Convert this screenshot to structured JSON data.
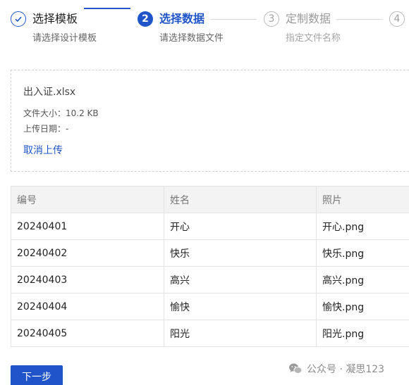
{
  "steps": [
    {
      "index": "1",
      "title": "选择模板",
      "description": "请选择设计模板",
      "status": "done",
      "icon": "check-icon"
    },
    {
      "index": "2",
      "title": "选择数据",
      "description": "请选择数据文件",
      "status": "active"
    },
    {
      "index": "3",
      "title": "定制数据",
      "description": "指定文件名称",
      "status": "wait"
    },
    {
      "index": "4",
      "title": "",
      "description": "",
      "status": "wait"
    }
  ],
  "upload": {
    "file_name": "出入证.xlsx",
    "size_text": "文件大小：10.2 KB",
    "date_text": "上传日期：-",
    "cancel_label": "取消上传"
  },
  "table": {
    "headers": [
      "编号",
      "姓名",
      "照片"
    ],
    "rows": [
      [
        "20240401",
        "开心",
        "开心.png"
      ],
      [
        "20240402",
        "快乐",
        "快乐.png"
      ],
      [
        "20240403",
        "高兴",
        "高兴.png"
      ],
      [
        "20240404",
        "愉快",
        "愉快.png"
      ],
      [
        "20240405",
        "阳光",
        "阳光.png"
      ]
    ]
  },
  "footer": {
    "next_label": "下一步",
    "watermark": "公众号 · 凝思123",
    "watermark_icon": "wechat-icon"
  },
  "colors": {
    "primary": "#1f55c8",
    "inactive": "#b8b8b8",
    "header_bg": "#f3f3f3"
  }
}
